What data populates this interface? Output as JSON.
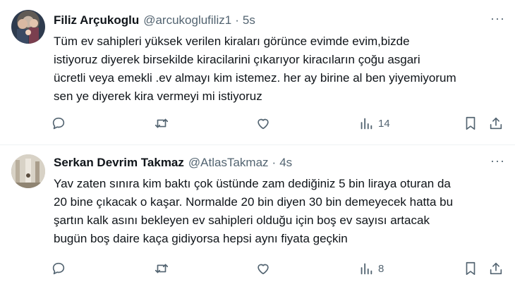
{
  "tweets": [
    {
      "name": "Filiz Arçukoglu",
      "handle": "@arcukoglufiliz1",
      "separator": "·",
      "time": "5s",
      "text": "Tüm ev sahipleri yüksek verilen kiraları görünce evimde  evim,bizde\nistiyoruz diyerek birsekilde kiracilarini çıkarıyor  kiracıların çoğu asgari\nücretli veya emekli .ev almayı kim istemez. her ay birine al ben yiyemiyorum\nsen ye diyerek kira vermeyi mi istiyoruz",
      "views": "14",
      "more": "···"
    },
    {
      "name": "Serkan Devrim Takmaz",
      "handle": "@AtlasTakmaz",
      "separator": "·",
      "time": "4s",
      "text": "Yav zaten sınıra kim baktı çok üstünde zam dediğiniz 5 bin liraya oturan da\n20 bine çıkacak o kaşar. Normalde 20 bin diyen 30 bin demeyecek hatta bu\nşartın kalk asını bekleyen ev sahipleri olduğu için boş ev sayısı artacak\nbugün boş daire kaça gidiyorsa hepsi aynı fiyata geçkin",
      "views": "8",
      "more": "···"
    }
  ],
  "icons": {
    "reply": "reply-icon",
    "retweet": "retweet-icon",
    "like": "heart-icon",
    "views": "views-chart-icon",
    "bookmark": "bookmark-icon",
    "share": "share-icon"
  },
  "colors": {
    "text": "#0f1419",
    "secondary": "#536471",
    "divider": "#eff3f4"
  }
}
